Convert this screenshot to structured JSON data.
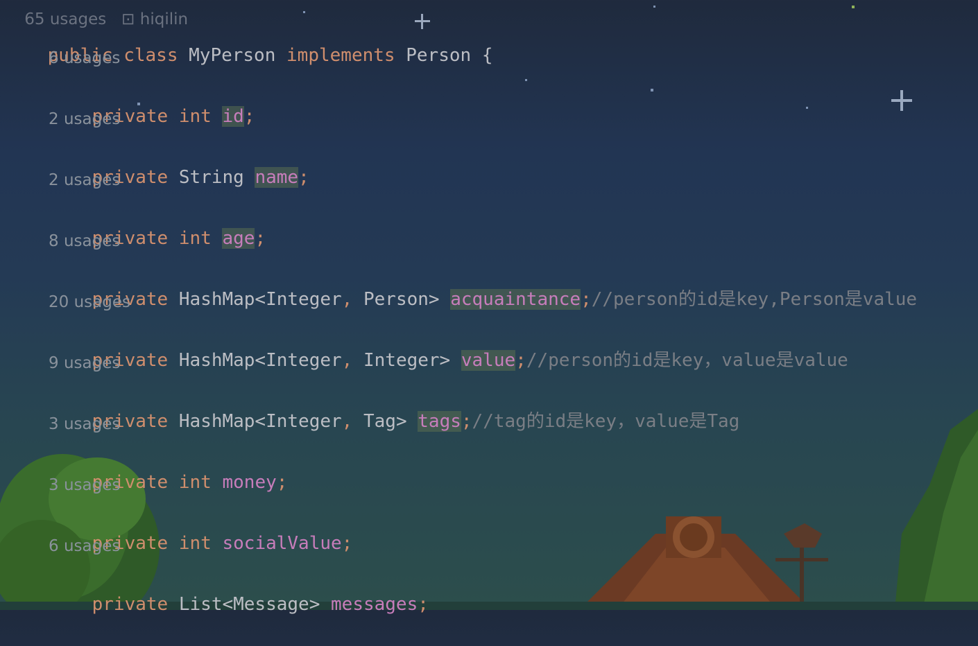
{
  "header_partial": {
    "usages": "65 usages",
    "author": "hiqilin"
  },
  "class_decl": {
    "kw1": "public",
    "kw2": "class",
    "name": "MyPerson",
    "kw3": "implements",
    "iface": "Person",
    "brace": "{"
  },
  "fields": [
    {
      "usages": "6 usages",
      "mod": "private",
      "type": "int",
      "name": "id",
      "semi": ";",
      "comment": "",
      "highlighted": true
    },
    {
      "usages": "2 usages",
      "mod": "private",
      "type": "String",
      "name": "name",
      "semi": ";",
      "comment": "",
      "highlighted": true
    },
    {
      "usages": "2 usages",
      "mod": "private",
      "type": "int",
      "name": "age",
      "semi": ";",
      "comment": "",
      "highlighted": true
    },
    {
      "usages": "8 usages",
      "mod": "private",
      "type_pre": "HashMap<Integer",
      "type_comma": ",",
      "type_post": " Person>",
      "name": "acquaintance",
      "semi": ";",
      "comment": "//person的id是key,Person是value",
      "highlighted": true
    },
    {
      "usages": "20 usages",
      "mod": "private",
      "type_pre": "HashMap<Integer",
      "type_comma": ",",
      "type_post": " Integer>",
      "name": "value",
      "semi": ";",
      "comment": "//person的id是key，value是value",
      "highlighted": true
    },
    {
      "usages": "9 usages",
      "mod": "private",
      "type_pre": "HashMap<Integer",
      "type_comma": ",",
      "type_post": " Tag>",
      "name": "tags",
      "semi": ";",
      "comment": "//tag的id是key，value是Tag",
      "highlighted": true
    },
    {
      "usages": "3 usages",
      "mod": "private",
      "type": "int",
      "name": "money",
      "semi": ";",
      "comment": "",
      "highlighted": false
    },
    {
      "usages": "3 usages",
      "mod": "private",
      "type": "int",
      "name": "socialValue",
      "semi": ";",
      "comment": "",
      "highlighted": false
    },
    {
      "usages": "6 usages",
      "mod": "private",
      "type": "List<Message>",
      "name": "messages",
      "semi": ";",
      "comment": "",
      "highlighted": false
    }
  ],
  "colors": {
    "keyword": "#cf8e6d",
    "type": "#bcbec4",
    "field": "#c77dbb",
    "comment": "#7a7e85",
    "usage_hint": "#8a929c"
  }
}
